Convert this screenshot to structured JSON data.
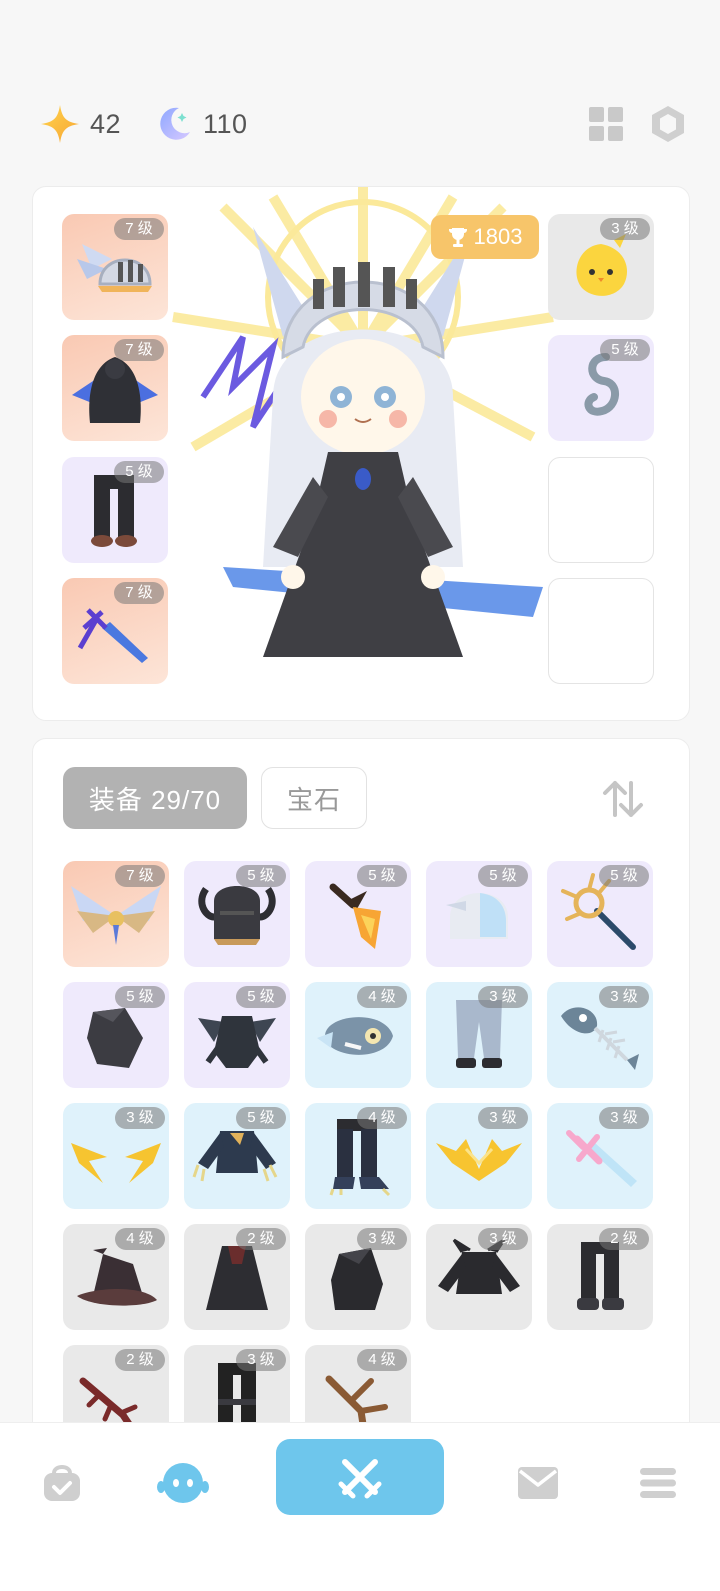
{
  "header": {
    "star_count": "42",
    "moon_count": "110",
    "icons": [
      "star-icon",
      "moon-icon",
      "grid-icon",
      "hexagon-icon"
    ]
  },
  "character": {
    "power_value": "1803",
    "left_slots": [
      {
        "level": "7 级",
        "item": "winged-helmet",
        "rarity": "orange"
      },
      {
        "level": "7 级",
        "item": "dark-cape",
        "rarity": "orange"
      },
      {
        "level": "5 级",
        "item": "black-boots",
        "rarity": "purple"
      },
      {
        "level": "7 级",
        "item": "blue-sword",
        "rarity": "orange"
      }
    ],
    "right_slots": [
      {
        "level": "3 级",
        "item": "yellow-chick-pet",
        "rarity": "gray"
      },
      {
        "level": "5 级",
        "item": "gray-hook",
        "rarity": "purple"
      },
      {
        "level": "",
        "item": "empty",
        "rarity": "empty"
      },
      {
        "level": "",
        "item": "empty",
        "rarity": "empty"
      }
    ]
  },
  "inventory": {
    "tab_equip_label": "装备 29/70",
    "tab_gem_label": "宝石",
    "items": [
      {
        "level": "7 级",
        "item": "angel-wings",
        "rarity": "orange"
      },
      {
        "level": "5 级",
        "item": "horned-helmet",
        "rarity": "purple"
      },
      {
        "level": "5 级",
        "item": "flame-dagger",
        "rarity": "purple"
      },
      {
        "level": "5 级",
        "item": "visor-helmet",
        "rarity": "purple"
      },
      {
        "level": "5 级",
        "item": "golden-staff",
        "rarity": "purple"
      },
      {
        "level": "5 级",
        "item": "dark-hood",
        "rarity": "purple"
      },
      {
        "level": "5 级",
        "item": "shadow-armor",
        "rarity": "purple"
      },
      {
        "level": "4 级",
        "item": "fish-helmet",
        "rarity": "blue"
      },
      {
        "level": "3 级",
        "item": "gray-pants",
        "rarity": "blue"
      },
      {
        "level": "3 级",
        "item": "fish-bone",
        "rarity": "blue"
      },
      {
        "level": "3 级",
        "item": "lightning-wings",
        "rarity": "blue"
      },
      {
        "level": "5 级",
        "item": "claw-armor",
        "rarity": "blue"
      },
      {
        "level": "4 级",
        "item": "claw-boots",
        "rarity": "blue"
      },
      {
        "level": "3 级",
        "item": "golden-crown",
        "rarity": "blue"
      },
      {
        "level": "3 级",
        "item": "pink-sword",
        "rarity": "blue"
      },
      {
        "level": "4 级",
        "item": "witch-hat",
        "rarity": "gray"
      },
      {
        "level": "2 级",
        "item": "black-robe",
        "rarity": "gray"
      },
      {
        "level": "3 级",
        "item": "black-hood",
        "rarity": "gray"
      },
      {
        "level": "3 级",
        "item": "spiked-armor",
        "rarity": "gray"
      },
      {
        "level": "2 级",
        "item": "black-boots-2",
        "rarity": "gray"
      },
      {
        "level": "2 级",
        "item": "red-branch",
        "rarity": "gray"
      },
      {
        "level": "3 级",
        "item": "dark-boots",
        "rarity": "gray"
      },
      {
        "level": "4 级",
        "item": "wood-branch",
        "rarity": "gray"
      }
    ]
  },
  "nav": {
    "items": [
      "shop-bag-icon",
      "character-icon",
      "battle-icon",
      "mail-icon",
      "menu-icon"
    ],
    "active": "character-icon",
    "accent": "#6ec6ec"
  }
}
